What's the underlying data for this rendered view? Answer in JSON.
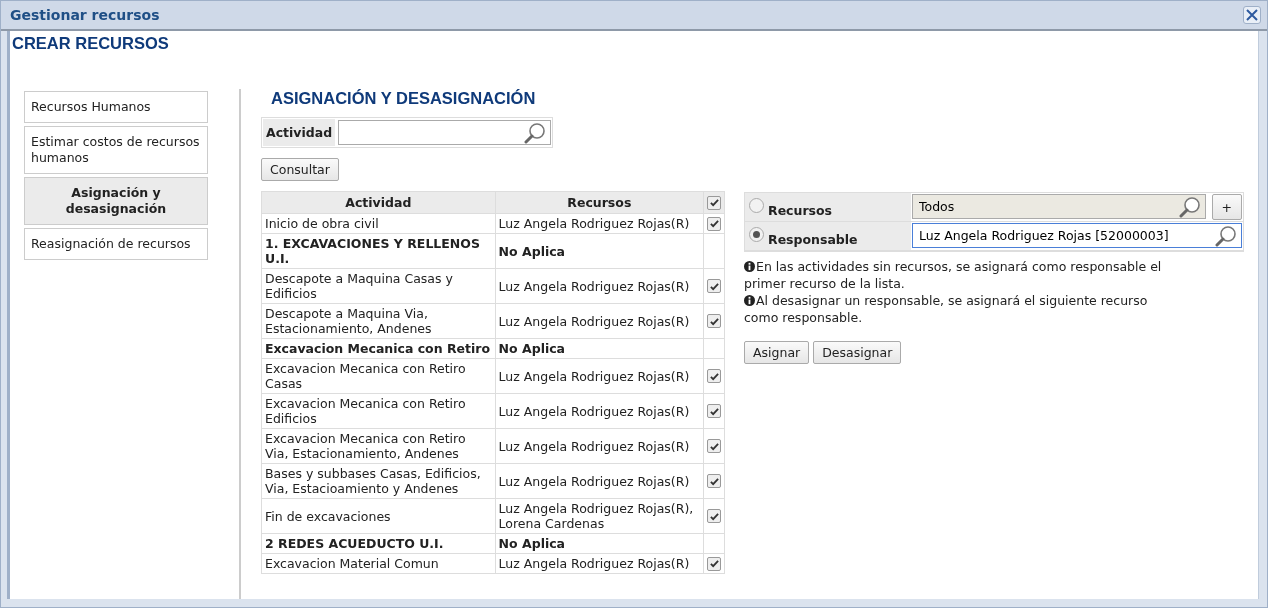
{
  "window": {
    "title": "Gestionar recursos"
  },
  "header": "CREAR RECURSOS",
  "sidebar": {
    "items": [
      {
        "label": "Recursos Humanos",
        "selected": false
      },
      {
        "label": "Estimar costos de recursos humanos",
        "selected": false
      },
      {
        "label": "Asignación y desasignación",
        "selected": true
      },
      {
        "label": "Reasignación de recursos",
        "selected": false
      }
    ]
  },
  "section_title": "ASIGNACIÓN Y DESASIGNACIÓN",
  "filter": {
    "label": "Actividad"
  },
  "query_button": "Consultar",
  "table": {
    "columns": [
      "Actividad",
      "Recursos"
    ],
    "select_all_checked": true,
    "rows": [
      {
        "kind": "task",
        "activity": "Inicio de obra civil",
        "resources": "Luz Angela Rodriguez Rojas(R)",
        "checked": true
      },
      {
        "kind": "group",
        "activity": "1. EXCAVACIONES Y RELLENOS U.I.",
        "resources": "No Aplica"
      },
      {
        "kind": "task",
        "activity": "Descapote a Maquina Casas y Edificios",
        "resources": "Luz Angela Rodriguez Rojas(R)",
        "checked": true
      },
      {
        "kind": "task",
        "activity": "Descapote a Maquina Via, Estacionamiento, Andenes",
        "resources": "Luz Angela Rodriguez Rojas(R)",
        "checked": true
      },
      {
        "kind": "group",
        "activity": "Excavacion Mecanica con Retiro",
        "resources": "No Aplica"
      },
      {
        "kind": "task",
        "activity": "Excavacion Mecanica con Retiro Casas",
        "resources": "Luz Angela Rodriguez Rojas(R)",
        "checked": true
      },
      {
        "kind": "task",
        "activity": "Excavacion Mecanica con Retiro Edificios",
        "resources": "Luz Angela Rodriguez Rojas(R)",
        "checked": true
      },
      {
        "kind": "task",
        "activity": "Excavacion Mecanica con Retiro Via, Estacionamiento, Andenes",
        "resources": "Luz Angela Rodriguez Rojas(R)",
        "checked": true
      },
      {
        "kind": "task",
        "activity": "Bases y subbases Casas, Edificios, Via, Estacioamiento y Andenes",
        "resources": "Luz Angela Rodriguez Rojas(R)",
        "checked": true
      },
      {
        "kind": "task",
        "activity": "Fin de excavaciones",
        "resources": "Luz Angela Rodriguez Rojas(R), Lorena Cardenas",
        "checked": true
      },
      {
        "kind": "group",
        "activity": "2 REDES ACUEDUCTO U.I.",
        "resources": "No Aplica"
      },
      {
        "kind": "task",
        "activity": "Excavacion Material Comun",
        "resources": "Luz Angela Rodriguez Rojas(R)",
        "checked": true
      }
    ]
  },
  "assign": {
    "options": [
      {
        "label": "Recursos",
        "selected": false,
        "value": "Todos",
        "add_button": "+"
      },
      {
        "label": "Responsable",
        "selected": true,
        "value": "Luz Angela Rodriguez Rojas [52000003]"
      }
    ],
    "notes": [
      "En las actividades sin recursos, se asignará como responsable el primer recurso de la lista.",
      "Al desasignar un responsable, se asignará el siguiente recurso como responsable."
    ],
    "buttons": [
      "Asignar",
      "Desasignar"
    ]
  }
}
